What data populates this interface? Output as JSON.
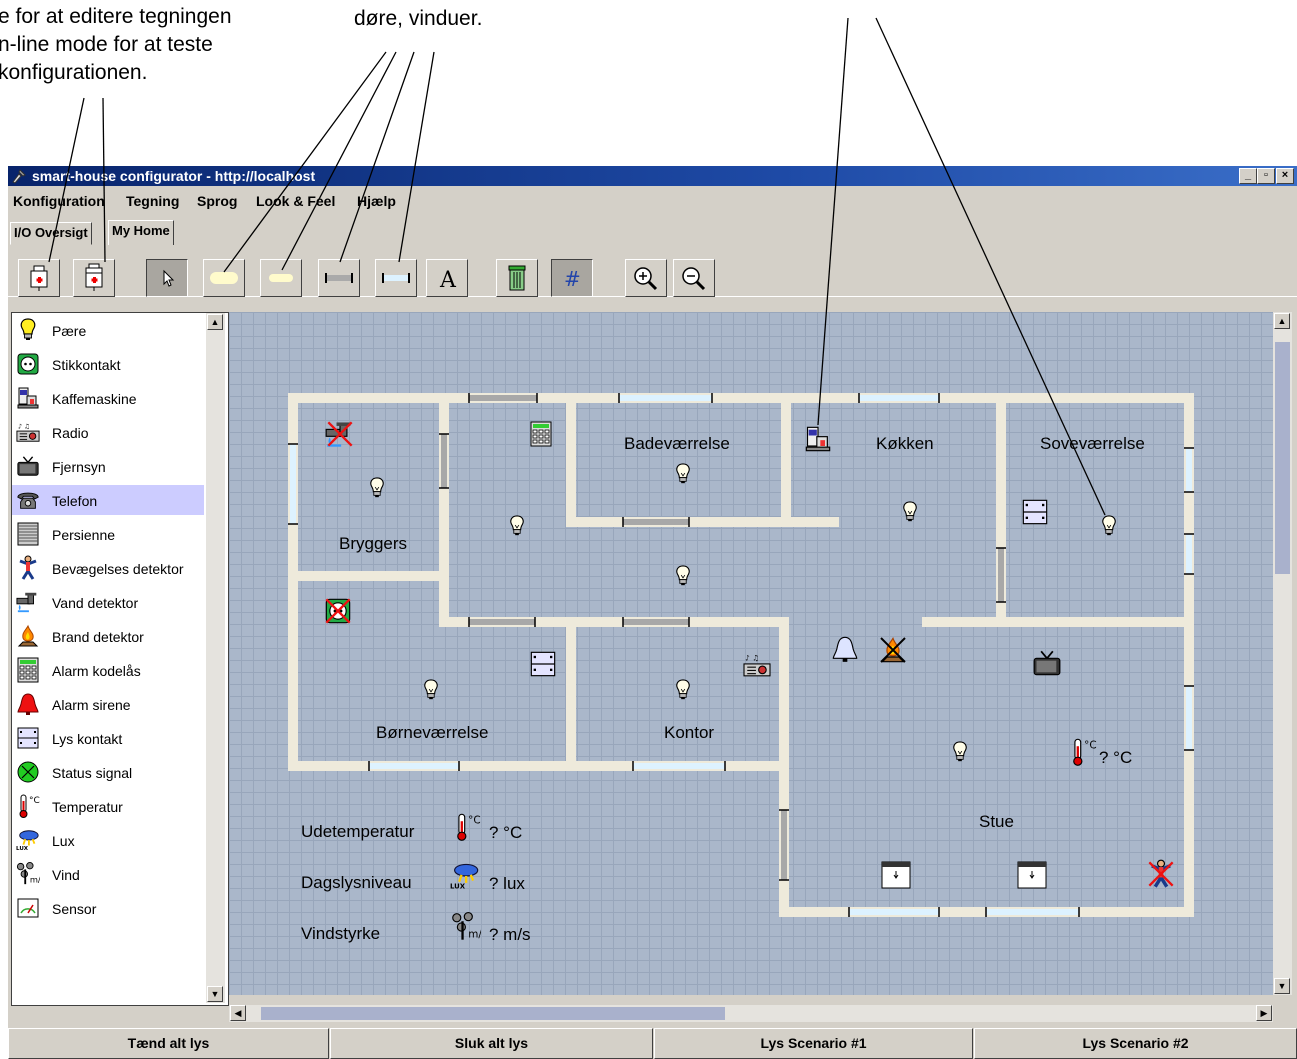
{
  "annotations": {
    "left_text": "e for at editere tegningen\nn-line mode for at teste\nkonfigurationen.",
    "mid_text": "døre, vinduer."
  },
  "window": {
    "title": "smart-house configurator - http://localhost",
    "minimize": "_",
    "maximize": "▫",
    "close": "×"
  },
  "menu": [
    "Konfiguration",
    "Tegning",
    "Sprog",
    "Look & Feel",
    "Hjælp"
  ],
  "tabs": [
    {
      "label": "I/O Oversigt",
      "selected": false
    },
    {
      "label": "My Home",
      "selected": true
    }
  ],
  "toolbar": {
    "tools": [
      "edit-mode",
      "online-mode",
      "select",
      "wall",
      "wall-light",
      "door",
      "window",
      "text",
      "delete",
      "grid",
      "zoom-in",
      "zoom-out"
    ],
    "text_tool_glyph": "A",
    "grid_glyph": "#",
    "pressed": [
      "select",
      "grid"
    ]
  },
  "palette": {
    "selected": "Telefon",
    "items": [
      {
        "label": "Pære",
        "icon": "bulb-icon"
      },
      {
        "label": "Stikkontakt",
        "icon": "socket-icon"
      },
      {
        "label": "Kaffemaskine",
        "icon": "coffee-machine-icon"
      },
      {
        "label": "Radio",
        "icon": "radio-icon"
      },
      {
        "label": "Fjernsyn",
        "icon": "tv-icon"
      },
      {
        "label": "Telefon",
        "icon": "phone-icon"
      },
      {
        "label": "Persienne",
        "icon": "blind-icon"
      },
      {
        "label": "Bevægelses detektor",
        "icon": "motion-detector-icon"
      },
      {
        "label": "Vand detektor",
        "icon": "water-detector-icon"
      },
      {
        "label": "Brand detektor",
        "icon": "fire-detector-icon"
      },
      {
        "label": "Alarm kodelås",
        "icon": "keypad-icon"
      },
      {
        "label": "Alarm sirene",
        "icon": "siren-icon"
      },
      {
        "label": "Lys kontakt",
        "icon": "light-switch-icon"
      },
      {
        "label": "Status signal",
        "icon": "status-signal-icon"
      },
      {
        "label": "Temperatur",
        "icon": "thermometer-icon"
      },
      {
        "label": "Lux",
        "icon": "lux-icon"
      },
      {
        "label": "Vind",
        "icon": "wind-icon"
      },
      {
        "label": "Sensor",
        "icon": "sensor-icon"
      }
    ]
  },
  "rooms": {
    "bryggers": "Bryggers",
    "badevaerelse": "Badeværrelse",
    "kokken": "Køkken",
    "sovevaerelse": "Soveværrelse",
    "bornevaerelse": "Børneværrelse",
    "kontor": "Kontor",
    "stue": "Stue"
  },
  "readings": {
    "stue_temp": "? °C",
    "outdoor_label": "Udetemperatur",
    "outdoor_value": "? °C",
    "daylight_label": "Dagslysniveau",
    "daylight_value": "? lux",
    "wind_label": "Vindstyrke",
    "wind_value": "? m/s"
  },
  "bottom_buttons": [
    "Tænd alt lys",
    "Sluk alt lys",
    "Lys Scenario #1",
    "Lys Scenario #2"
  ],
  "colors": {
    "title_bar": "#0a246a",
    "canvas_bg": "#aab7ca",
    "wall": "#eeeadb",
    "window_pane": "#ddf2ff",
    "door": "#a8a8a8",
    "palette_selected": "#ccccff"
  }
}
